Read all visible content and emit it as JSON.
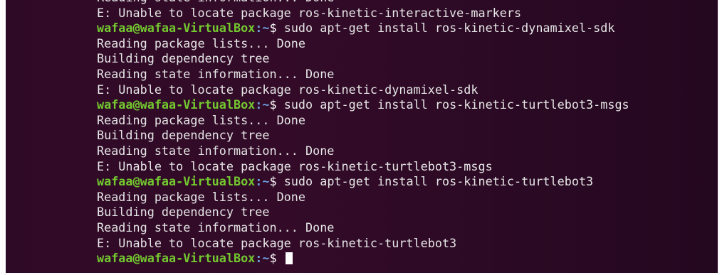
{
  "terminal": {
    "colors": {
      "background": "#300a24",
      "text": "#e6e6e6",
      "user": "#73c92f",
      "path": "#6f9ee0"
    },
    "prompt": {
      "user_host": "wafaa@wafaa-VirtualBox",
      "path": "~",
      "symbol": "$"
    },
    "lines": [
      {
        "type": "output",
        "text": "Reading state information... Done"
      },
      {
        "type": "output",
        "text": "E: Unable to locate package ros-kinetic-interactive-markers"
      },
      {
        "type": "prompt",
        "command": " sudo apt-get install ros-kinetic-dynamixel-sdk"
      },
      {
        "type": "output",
        "text": "Reading package lists... Done"
      },
      {
        "type": "output",
        "text": "Building dependency tree"
      },
      {
        "type": "output",
        "text": "Reading state information... Done"
      },
      {
        "type": "output",
        "text": "E: Unable to locate package ros-kinetic-dynamixel-sdk"
      },
      {
        "type": "prompt",
        "command": " sudo apt-get install ros-kinetic-turtlebot3-msgs"
      },
      {
        "type": "output",
        "text": "Reading package lists... Done"
      },
      {
        "type": "output",
        "text": "Building dependency tree"
      },
      {
        "type": "output",
        "text": "Reading state information... Done"
      },
      {
        "type": "output",
        "text": "E: Unable to locate package ros-kinetic-turtlebot3-msgs"
      },
      {
        "type": "prompt",
        "command": " sudo apt-get install ros-kinetic-turtlebot3"
      },
      {
        "type": "output",
        "text": "Reading package lists... Done"
      },
      {
        "type": "output",
        "text": "Building dependency tree"
      },
      {
        "type": "output",
        "text": "Reading state information... Done"
      },
      {
        "type": "output",
        "text": "E: Unable to locate package ros-kinetic-turtlebot3"
      },
      {
        "type": "prompt",
        "command": " ",
        "cursor": true
      }
    ]
  }
}
